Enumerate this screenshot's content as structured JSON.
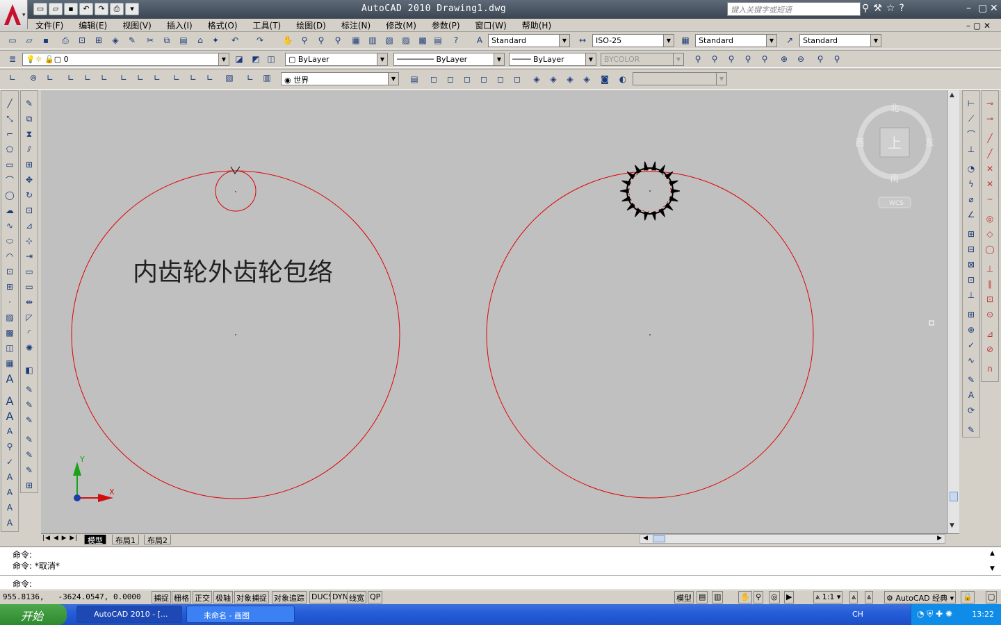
{
  "title": "AutoCAD 2010   Drawing1.dwg",
  "search_placeholder": "键入关键字或短语",
  "menu": [
    "文件(F)",
    "编辑(E)",
    "视图(V)",
    "插入(I)",
    "格式(O)",
    "工具(T)",
    "绘图(D)",
    "标注(N)",
    "修改(M)",
    "参数(P)",
    "窗口(W)",
    "帮助(H)"
  ],
  "styles": {
    "text_style": "Standard",
    "dim_style": "ISO-25",
    "table_style": "Standard",
    "mleader_style": "Standard"
  },
  "layer": {
    "current": "0"
  },
  "props": {
    "color": "ByLayer",
    "linetype": "ByLayer",
    "lineweight": "ByLayer",
    "plotstyle": "BYCOLOR"
  },
  "ucs": {
    "name": "世界"
  },
  "viewcube": {
    "face": "上",
    "north": "北",
    "south": "南",
    "east": "东",
    "west": "西",
    "wcs": "WCS"
  },
  "drawing": {
    "annotation": "内齿轮外齿轮包络",
    "axis_x": "X",
    "axis_y": "Y",
    "circle_color": "#e00000"
  },
  "layout_tabs": [
    "模型",
    "布局1",
    "布局2"
  ],
  "command_lines": [
    "命令:",
    "命令: *取消*",
    "命令:"
  ],
  "status": {
    "coords": "955.8136,   -3624.0547, 0.0000",
    "toggles": [
      "捕捉",
      "栅格",
      "正交",
      "极轴",
      "对象捕捉",
      "对象追踪",
      "DUCS",
      "DYN",
      "线宽",
      "QP"
    ],
    "model": "模型",
    "scale": "1:1",
    "workspace": "AutoCAD 经典"
  },
  "taskbar": {
    "start": "开始",
    "tasks": [
      "AutoCAD 2010 - [...",
      "未命名 - 画图"
    ],
    "lang": "CH",
    "time": "13:22"
  }
}
